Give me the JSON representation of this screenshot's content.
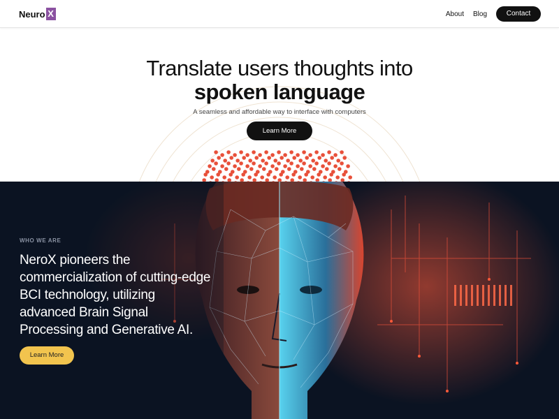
{
  "header": {
    "logo_text": "Neuro",
    "logo_mark": "X",
    "logo_mark_color": "#8b52a1",
    "nav": {
      "about": "About",
      "blog": "Blog",
      "contact": "Contact"
    }
  },
  "hero": {
    "title_line1": "Translate users thoughts into",
    "title_line2": "spoken language",
    "subtitle": "A seamless and affordable way to interface with computers",
    "cta": "Learn More"
  },
  "about": {
    "eyebrow": "WHO WE ARE",
    "body": "NeroX pioneers the commercialization of cutting-edge BCI technology, utilizing advanced Brain Signal Processing and Generative AI.",
    "cta": "Learn More",
    "cta_color": "#f2c44e"
  },
  "colors": {
    "dark_bg": "#0b1322",
    "accent_red": "#e8503a",
    "accent_cyan": "#3fc4e6"
  }
}
